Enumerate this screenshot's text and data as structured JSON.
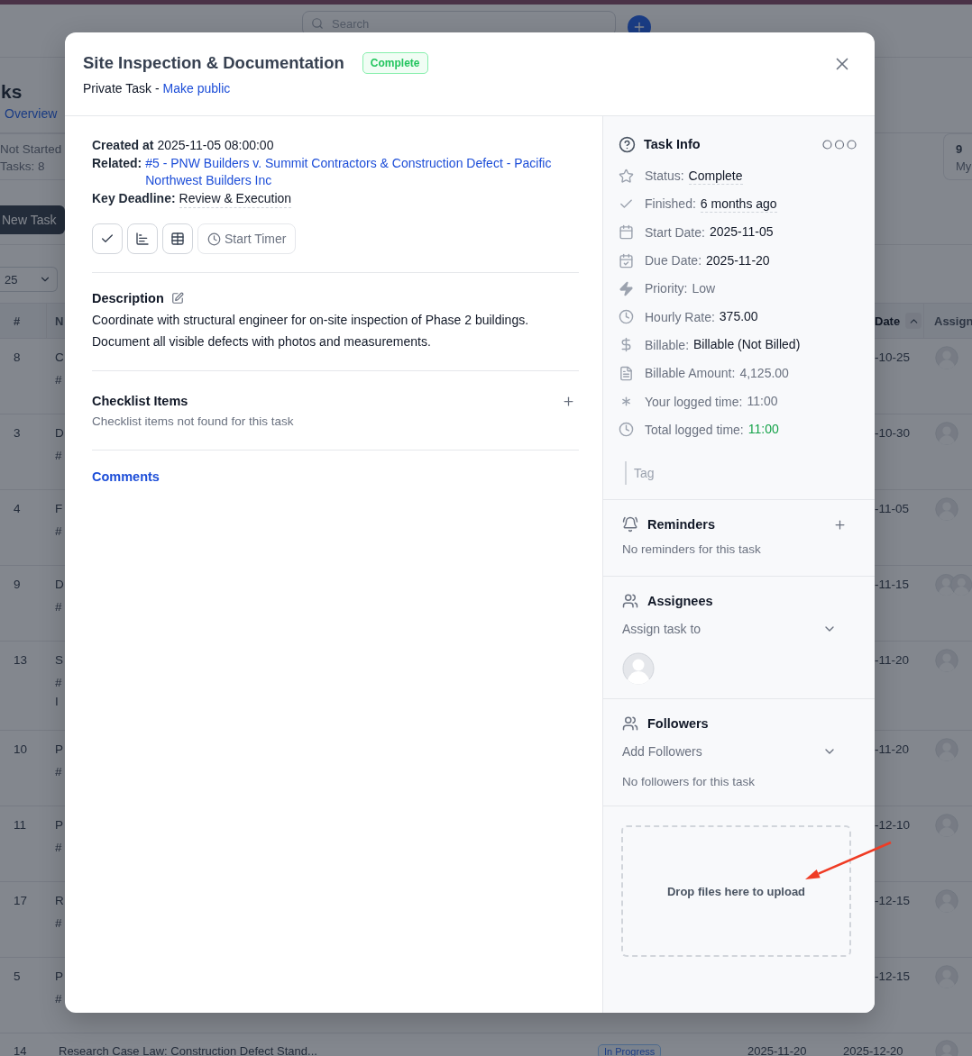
{
  "page": {
    "search": {
      "placeholder": "Search"
    },
    "title": "ks",
    "breadcrumb_link": "Overview",
    "stat_cards": [
      {
        "label": "Not Started",
        "sublabel": "Tasks: 8"
      },
      {
        "count": "9",
        "sublabel": "My"
      }
    ],
    "new_task_button": "New Task",
    "page_size": "25",
    "table": {
      "columns": [
        {
          "label": "#",
          "sorted": false
        },
        {
          "label": "N",
          "sorted": false
        },
        {
          "label": "Date",
          "sorted": true
        },
        {
          "label": "Assign",
          "sorted": false
        }
      ],
      "rows": [
        {
          "number": "8",
          "name_lines": [
            "C",
            "#"
          ],
          "due": "-10-25",
          "multiple_assignees": false
        },
        {
          "number": "3",
          "name_lines": [
            "D",
            "#"
          ],
          "due": "-10-30",
          "multiple_assignees": false
        },
        {
          "number": "4",
          "name_lines": [
            "F",
            "#"
          ],
          "due": "-11-05",
          "multiple_assignees": false
        },
        {
          "number": "9",
          "name_lines": [
            "D",
            "#"
          ],
          "due": "-11-15",
          "multiple_assignees": true
        },
        {
          "number": "13",
          "name_lines": [
            "S",
            "#",
            "I"
          ],
          "due": "-11-20",
          "multiple_assignees": false
        },
        {
          "number": "10",
          "name_lines": [
            "P",
            "#"
          ],
          "due": "-11-20",
          "multiple_assignees": false
        },
        {
          "number": "11",
          "name_lines": [
            "P",
            "#"
          ],
          "due": "-12-10",
          "multiple_assignees": false
        },
        {
          "number": "17",
          "name_lines": [
            "R",
            "#"
          ],
          "due": "-12-15",
          "multiple_assignees": false
        },
        {
          "number": "5",
          "name_lines": [
            "P",
            "#"
          ],
          "due": "-12-15",
          "multiple_assignees": false
        }
      ],
      "bottom_row": {
        "number": "14",
        "name": "Research Case Law: Construction Defect Stand...",
        "status": "In Progress",
        "start": "2025-11-20",
        "due": "2025-12-20",
        "multiple_assignees": false
      }
    }
  },
  "modal": {
    "title": "Site Inspection & Documentation",
    "status_badge": "Complete",
    "privacy": {
      "label": "Private Task -",
      "action": "Make public"
    },
    "details": [
      {
        "kind": "text",
        "label": "Created at",
        "value": "2025-11-05 08:00:00"
      },
      {
        "kind": "link",
        "label": "Related:",
        "value": "#5 - PNW Builders v. Summit Contractors & Construction Defect - Pacific Northwest Builders Inc"
      },
      {
        "kind": "editable",
        "label": "Key Deadline:",
        "value": "Review & Execution"
      }
    ],
    "actions": [
      {
        "kind": "check"
      },
      {
        "kind": "chart"
      },
      {
        "kind": "table"
      },
      {
        "kind": "timer",
        "label": "Start Timer"
      }
    ],
    "description": {
      "title": "Description",
      "text": "Coordinate with structural engineer for on-site inspection of Phase 2 buildings. Document all visible defects with photos and measurements."
    },
    "checklist": {
      "title": "Checklist Items",
      "empty_text": "Checklist items not found for this task"
    },
    "comments_tab": "Comments",
    "task_info": {
      "title": "Task Info",
      "rows": [
        {
          "kind": "status",
          "label": "Status:",
          "value": "Complete",
          "muted": false,
          "editable": true
        },
        {
          "kind": "finished",
          "label": "Finished:",
          "value": "6 months ago",
          "muted": false,
          "editable": true
        },
        {
          "kind": "start",
          "label": "Start Date:",
          "value": "2025-11-05",
          "muted": false,
          "editable": false
        },
        {
          "kind": "due",
          "label": "Due Date:",
          "value": "2025-11-20",
          "muted": false,
          "editable": false
        },
        {
          "kind": "priority",
          "label": "Priority:",
          "value": "Low",
          "muted": true,
          "editable": false
        },
        {
          "kind": "rate",
          "label": "Hourly Rate:",
          "value": "375.00",
          "muted": false,
          "editable": false
        },
        {
          "kind": "billable",
          "label": "Billable:",
          "value": "Billable (Not Billed)",
          "muted": false,
          "editable": false
        },
        {
          "kind": "amount",
          "label": "Billable Amount:",
          "value": "4,125.00",
          "muted": true,
          "editable": false
        },
        {
          "kind": "mine",
          "label": "Your logged time:",
          "value": "11:00",
          "muted": true,
          "editable": false
        },
        {
          "kind": "total",
          "label": "Total logged time:",
          "value": "11:00",
          "muted": false,
          "editable": false
        }
      ],
      "tag_placeholder": "Tag"
    },
    "reminders": {
      "title": "Reminders",
      "empty_text": "No reminders for this task"
    },
    "assignees": {
      "title": "Assignees",
      "select_placeholder": "Assign task to",
      "has_assignee": true
    },
    "followers": {
      "title": "Followers",
      "select_placeholder": "Add Followers",
      "empty_text": "No followers for this task"
    },
    "dropzone": "Drop files here to upload"
  },
  "annotations": [
    {
      "kind": "arrow"
    }
  ]
}
